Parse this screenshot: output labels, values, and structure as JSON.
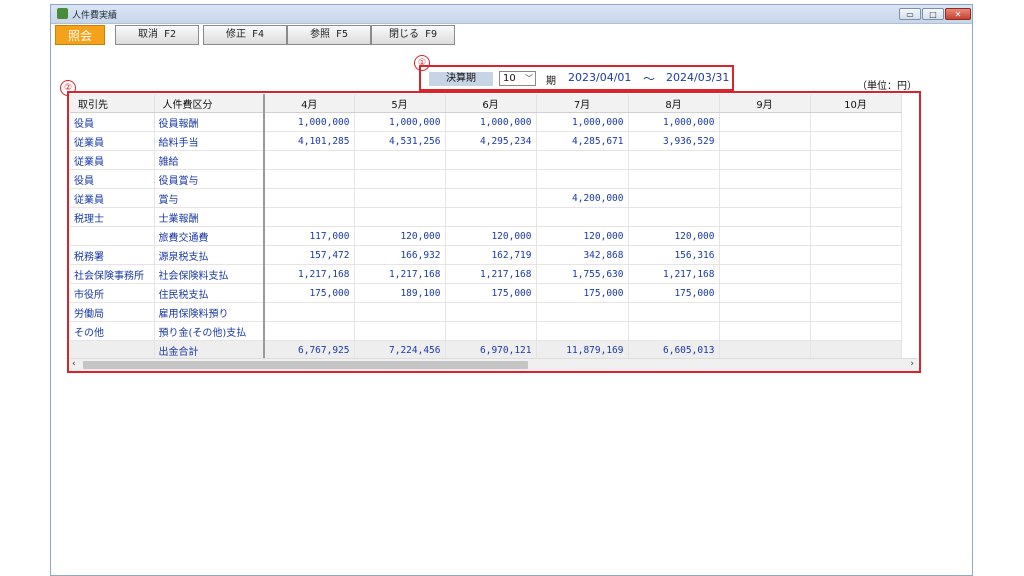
{
  "window": {
    "title": "人件費実績",
    "controls": {
      "minimize": "▭",
      "maximize": "□",
      "close": "✕"
    }
  },
  "toolbar": {
    "mode_label": "照会",
    "cancel_label": "取消 F2",
    "edit_label": "修正 F4",
    "reference_label": "参照 F5",
    "close_label": "閉じる F9"
  },
  "period": {
    "label": "決算期",
    "selected": "10",
    "suffix": "期",
    "from": "2023/04/01",
    "separator": "～",
    "to": "2024/03/31"
  },
  "annotations": {
    "marker1": "①",
    "marker2": "②"
  },
  "unit_label": "（単位：円）",
  "table": {
    "columns": [
      "取引先",
      "人件費区分",
      "4月",
      "5月",
      "6月",
      "7月",
      "8月",
      "9月",
      "10月"
    ],
    "rows": [
      {
        "partner": "役員",
        "category": "役員報酬",
        "values": [
          "1,000,000",
          "1,000,000",
          "1,000,000",
          "1,000,000",
          "1,000,000",
          "",
          ""
        ]
      },
      {
        "partner": "従業員",
        "category": "給料手当",
        "values": [
          "4,101,285",
          "4,531,256",
          "4,295,234",
          "4,285,671",
          "3,936,529",
          "",
          ""
        ]
      },
      {
        "partner": "従業員",
        "category": "雑給",
        "values": [
          "",
          "",
          "",
          "",
          "",
          "",
          ""
        ]
      },
      {
        "partner": "役員",
        "category": "役員賞与",
        "values": [
          "",
          "",
          "",
          "",
          "",
          "",
          ""
        ]
      },
      {
        "partner": "従業員",
        "category": "賞与",
        "values": [
          "",
          "",
          "",
          "4,200,000",
          "",
          "",
          ""
        ]
      },
      {
        "partner": "税理士",
        "category": "士業報酬",
        "values": [
          "",
          "",
          "",
          "",
          "",
          "",
          ""
        ]
      },
      {
        "partner": "",
        "category": "旅費交通費",
        "values": [
          "117,000",
          "120,000",
          "120,000",
          "120,000",
          "120,000",
          "",
          ""
        ]
      },
      {
        "partner": "税務署",
        "category": "源泉税支払",
        "values": [
          "157,472",
          "166,932",
          "162,719",
          "342,868",
          "156,316",
          "",
          ""
        ]
      },
      {
        "partner": "社会保険事務所",
        "category": "社会保険料支払",
        "values": [
          "1,217,168",
          "1,217,168",
          "1,217,168",
          "1,755,630",
          "1,217,168",
          "",
          ""
        ]
      },
      {
        "partner": "市役所",
        "category": "住民税支払",
        "values": [
          "175,000",
          "189,100",
          "175,000",
          "175,000",
          "175,000",
          "",
          ""
        ]
      },
      {
        "partner": "労働局",
        "category": "雇用保険料預り",
        "values": [
          "",
          "",
          "",
          "",
          "",
          "",
          ""
        ]
      },
      {
        "partner": "その他",
        "category": "預り金(その他)支払",
        "values": [
          "",
          "",
          "",
          "",
          "",
          "",
          ""
        ]
      },
      {
        "partner": "",
        "category": "出金合計",
        "values": [
          "6,767,925",
          "7,224,456",
          "6,970,121",
          "11,879,169",
          "6,605,013",
          "",
          ""
        ]
      }
    ]
  },
  "scrollbar": {
    "left_arrow": "‹",
    "right_arrow": "›"
  }
}
